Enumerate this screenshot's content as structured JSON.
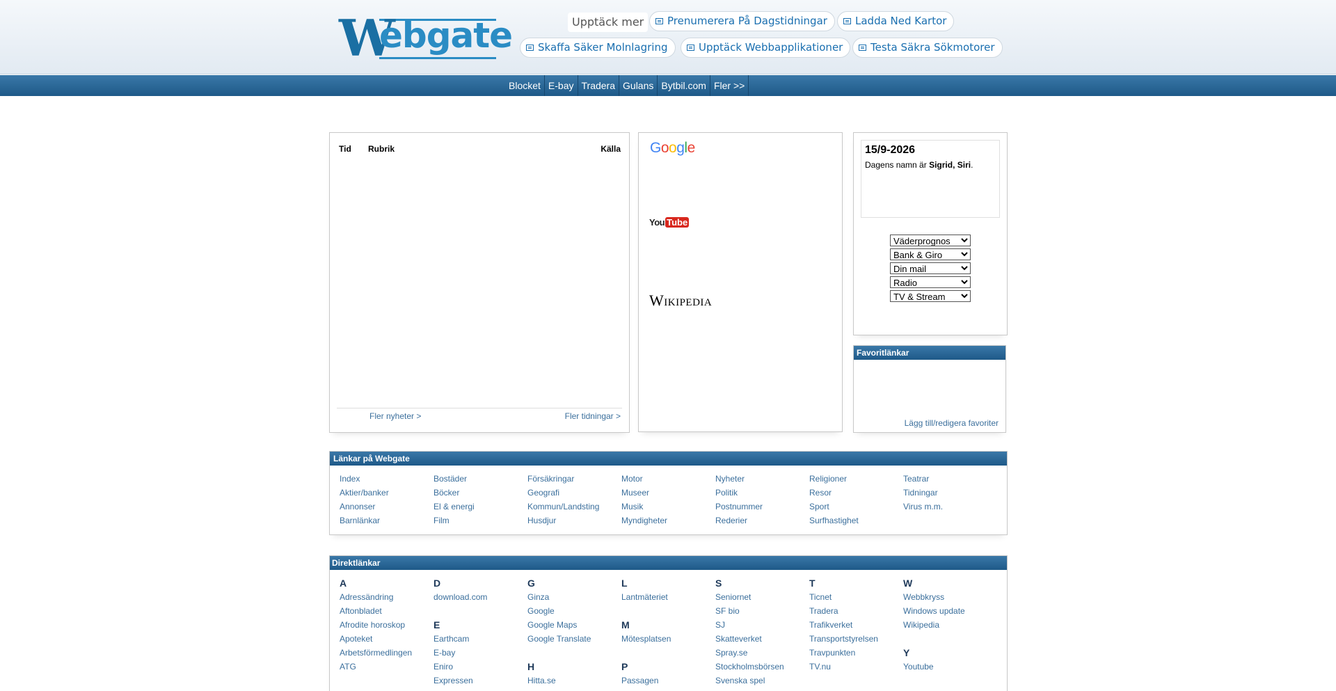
{
  "header": {
    "logo_w": "W",
    "logo_rest": "ebgate",
    "discover": "Upptäck mer",
    "promos": [
      "Prenumerera På Dagstidningar",
      "Ladda Ned Kartor",
      "Skaffa Säker Molnlagring",
      "Upptäck Webbapplikationer",
      "Testa Säkra Sökmotorer"
    ]
  },
  "nav": [
    "Blocket",
    "E-bay",
    "Tradera",
    "Gulans",
    "Bytbil.com",
    "Fler >>"
  ],
  "news": {
    "col_time": "Tid",
    "col_title": "Rubrik",
    "col_source": "Källa",
    "more_news": "Fler nyheter >",
    "more_papers": "Fler tidningar >"
  },
  "search": {
    "google": [
      "G",
      "o",
      "o",
      "g",
      "l",
      "e"
    ],
    "youtube_you": "You",
    "youtube_tube": "Tube",
    "wikipedia": "Wikipedia"
  },
  "colors": {
    "google": [
      "#4285f4",
      "#ea4335",
      "#fbbc05",
      "#4285f4",
      "#34a853",
      "#ea4335"
    ]
  },
  "date": {
    "title": "15/9-2026",
    "prefix": "Dagens namn är ",
    "names": "Sigrid, Siri",
    "suffix": "."
  },
  "dropdowns": [
    "Väderprognos",
    "Bank & Giro",
    "Din mail",
    "Radio",
    "TV & Stream"
  ],
  "favorites": {
    "title": "Favoritlänkar",
    "edit": "Lägg till/redigera favoriter"
  },
  "webgate_links": {
    "title": "Länkar på Webgate",
    "columns": [
      [
        "Index",
        "Aktier/banker",
        "Annonser",
        "Barnlänkar"
      ],
      [
        "Bostäder",
        "Böcker",
        "El & energi",
        "Film"
      ],
      [
        "Försäkringar",
        "Geografi",
        "Kommun/Landsting",
        "Husdjur"
      ],
      [
        "Motor",
        "Museer",
        "Musik",
        "Myndigheter"
      ],
      [
        "Nyheter",
        "Politik",
        "Postnummer",
        "Rederier"
      ],
      [
        "Religioner",
        "Resor",
        "Sport",
        "Surfhastighet"
      ],
      [
        "Teatrar",
        "Tidningar",
        "Virus m.m."
      ]
    ]
  },
  "direct_links": {
    "title": "Direktlänkar",
    "columns": [
      [
        {
          "letter": "A"
        },
        {
          "link": "Adressändring"
        },
        {
          "link": "Aftonbladet"
        },
        {
          "link": "Afrodite horoskop"
        },
        {
          "link": "Apoteket"
        },
        {
          "link": "Arbetsförmedlingen"
        },
        {
          "link": "ATG"
        }
      ],
      [
        {
          "letter": "D"
        },
        {
          "link": "download.com"
        },
        {
          "gap": true
        },
        {
          "letter": "E"
        },
        {
          "link": "Earthcam"
        },
        {
          "link": "E-bay"
        },
        {
          "link": "Eniro"
        },
        {
          "link": "Expressen"
        }
      ],
      [
        {
          "letter": "G"
        },
        {
          "link": "Ginza"
        },
        {
          "link": "Google"
        },
        {
          "link": "Google Maps"
        },
        {
          "link": "Google Translate"
        },
        {
          "gap": true
        },
        {
          "letter": "H"
        },
        {
          "link": "Hitta.se"
        }
      ],
      [
        {
          "letter": "L"
        },
        {
          "link": "Lantmäteriet"
        },
        {
          "gap": true
        },
        {
          "letter": "M"
        },
        {
          "link": "Mötesplatsen"
        },
        {
          "gap": true
        },
        {
          "letter": "P"
        },
        {
          "link": "Passagen"
        }
      ],
      [
        {
          "letter": "S"
        },
        {
          "link": "Seniornet"
        },
        {
          "link": "SF bio"
        },
        {
          "link": "SJ"
        },
        {
          "link": "Skatteverket"
        },
        {
          "link": "Spray.se"
        },
        {
          "link": "Stockholmsbörsen"
        },
        {
          "link": "Svenska spel"
        }
      ],
      [
        {
          "letter": "T"
        },
        {
          "link": "Ticnet"
        },
        {
          "link": "Tradera"
        },
        {
          "link": "Trafikverket"
        },
        {
          "link": "Transportstyrelsen"
        },
        {
          "link": "Travpunkten"
        },
        {
          "link": "TV.nu"
        }
      ],
      [
        {
          "letter": "W"
        },
        {
          "link": "Webbkryss"
        },
        {
          "link": "Windows update"
        },
        {
          "link": "Wikipedia"
        },
        {
          "gap": true
        },
        {
          "letter": "Y"
        },
        {
          "link": "Youtube"
        }
      ]
    ]
  }
}
